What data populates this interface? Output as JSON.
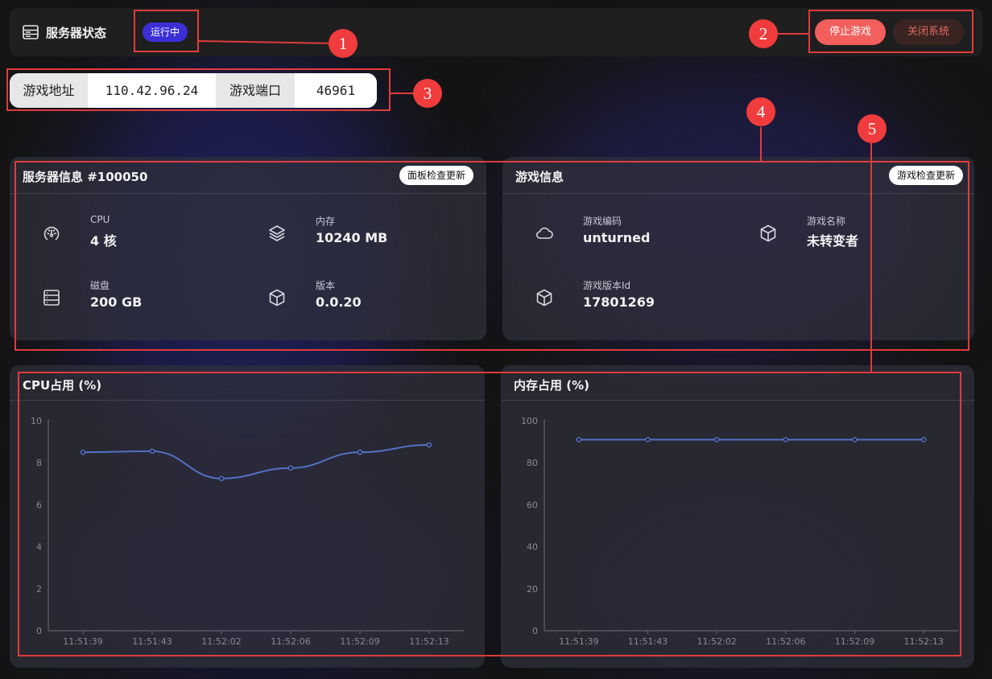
{
  "topbar": {
    "title": "服务器状态",
    "status": "运行中",
    "stop_label": "停止游戏",
    "close_label": "关闭系统"
  },
  "address": {
    "host_label": "游戏地址",
    "host_value": "110.42.96.24",
    "port_label": "游戏端口",
    "port_value": "46961"
  },
  "server_info": {
    "title": "服务器信息 #100050",
    "update_label": "面板检查更新",
    "cpu": {
      "label": "CPU",
      "value": "4 核",
      "icon": "gauge-icon"
    },
    "memory": {
      "label": "内存",
      "value": "10240 MB",
      "icon": "layers-icon"
    },
    "disk": {
      "label": "磁盘",
      "value": "200 GB",
      "icon": "database-icon"
    },
    "version": {
      "label": "版本",
      "value": "0.0.20",
      "icon": "cube-icon"
    }
  },
  "game_info": {
    "title": "游戏信息",
    "update_label": "游戏检查更新",
    "code": {
      "label": "游戏编码",
      "value": "unturned",
      "icon": "cloud-icon"
    },
    "name": {
      "label": "游戏名称",
      "value": "未转变者",
      "icon": "cube-icon"
    },
    "version_id": {
      "label": "游戏版本Id",
      "value": "17801269",
      "icon": "cube-icon"
    }
  },
  "annotations": [
    "1",
    "2",
    "3",
    "4",
    "5"
  ],
  "colors": {
    "status": "#3a2fd6",
    "stop": "#f25f5c",
    "line": "#5470c6",
    "annotation": "#f03c3c"
  },
  "chart_data": [
    {
      "type": "line",
      "title": "CPU占用 (%)",
      "categories": [
        "11:51:39",
        "11:51:43",
        "11:52:02",
        "11:52:06",
        "11:52:09",
        "11:52:13"
      ],
      "series": [
        {
          "values": [
            8.5,
            8.55,
            7.25,
            7.75,
            8.5,
            8.85
          ]
        }
      ],
      "ylim": [
        0,
        10
      ],
      "yticks": [
        0,
        2,
        4,
        6,
        8,
        10
      ],
      "grid": false,
      "smooth": true
    },
    {
      "type": "line",
      "title": "内存占用 (%)",
      "categories": [
        "11:51:39",
        "11:51:43",
        "11:52:02",
        "11:52:06",
        "11:52:09",
        "11:52:13"
      ],
      "series": [
        {
          "values": [
            91,
            91,
            91,
            91,
            91,
            91
          ]
        }
      ],
      "ylim": [
        0,
        100
      ],
      "yticks": [
        0,
        20,
        40,
        60,
        80,
        100
      ],
      "grid": false,
      "smooth": true
    }
  ]
}
